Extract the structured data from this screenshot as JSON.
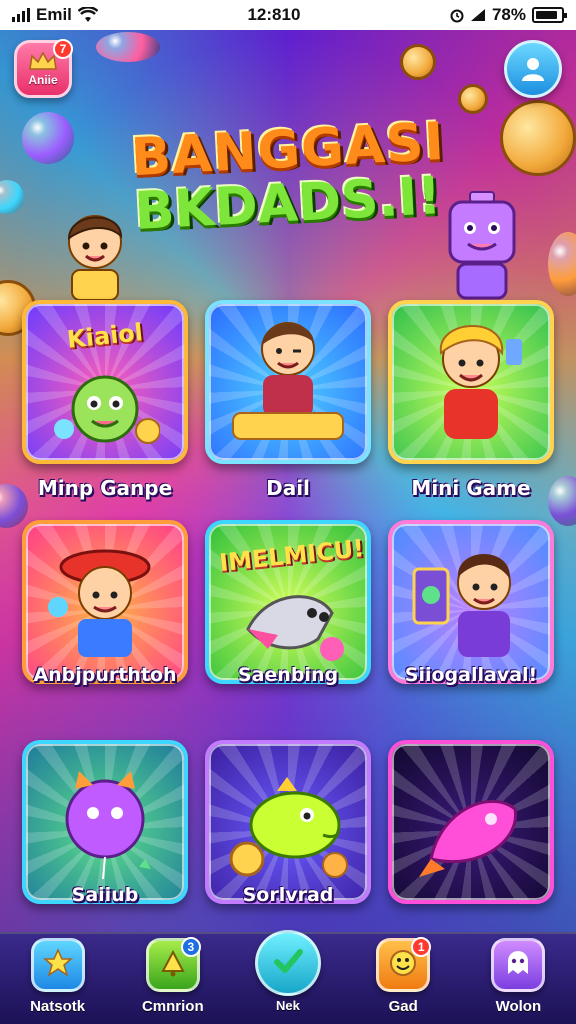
{
  "status_bar": {
    "carrier": "Emil",
    "time": "12:810",
    "battery": "78%"
  },
  "top_left_button": {
    "label": "Aniie",
    "badge": "7"
  },
  "title": {
    "line1": "BANGGASI",
    "line2": "BKDADS.I!"
  },
  "games": [
    {
      "label": "Minp Ganpe",
      "banner": "Kiaiol",
      "border": "#ffb938",
      "bg1": "#ff5fb7",
      "bg2": "#6a3cff"
    },
    {
      "label": "Dail",
      "banner": "",
      "border": "#7be3ff",
      "bg1": "#4fd0ff",
      "bg2": "#2b6bff"
    },
    {
      "label": "Mini Game",
      "banner": "",
      "border": "#ffd34d",
      "bg1": "#c9ff5a",
      "bg2": "#2fbf4f"
    },
    {
      "label": "Anbjpurthtoh",
      "banner": "",
      "border": "#ff9d3a",
      "bg1": "#ffb347",
      "bg2": "#ff3c8a"
    },
    {
      "label": "Saenbing",
      "banner": "IMELMICU!",
      "border": "#3cd6ff",
      "bg1": "#d4ff5a",
      "bg2": "#2ebf3c"
    },
    {
      "label": "Siiogallaval!",
      "banner": "",
      "border": "#ff7ad9",
      "bg1": "#b982ff",
      "bg2": "#4a8cff"
    },
    {
      "label": "Saiiub",
      "banner": "",
      "border": "#3cd6ff",
      "bg1": "#5fe08a",
      "bg2": "#1d7a9c"
    },
    {
      "label": "Sorlvrad",
      "banner": "",
      "border": "#c27bff",
      "bg1": "#6a5cff",
      "bg2": "#3b1e9e"
    },
    {
      "label": "",
      "banner": "",
      "border": "#ff4fd8",
      "bg1": "#3a1a7a",
      "bg2": "#12082e"
    }
  ],
  "bottom_nav": [
    {
      "label": "Natsotk",
      "icon": "star-icon",
      "color1": "#5fd6ff",
      "color2": "#1e88e5",
      "active": false,
      "badge": ""
    },
    {
      "label": "Cmnrion",
      "icon": "bell-icon",
      "color1": "#a6ec4a",
      "color2": "#3aa51c",
      "active": false,
      "badge": "3"
    },
    {
      "label": "Nek",
      "icon": "check-icon",
      "color1": "#6ff0ff",
      "color2": "#18a7c9",
      "active": true,
      "badge": ""
    },
    {
      "label": "Gad",
      "icon": "smile-icon",
      "color1": "#ffc04a",
      "color2": "#f07b12",
      "active": false,
      "badge": "1"
    },
    {
      "label": "Wolon",
      "icon": "ghost-icon",
      "color1": "#d08bff",
      "color2": "#7b3fe0",
      "active": false,
      "badge": ""
    }
  ]
}
